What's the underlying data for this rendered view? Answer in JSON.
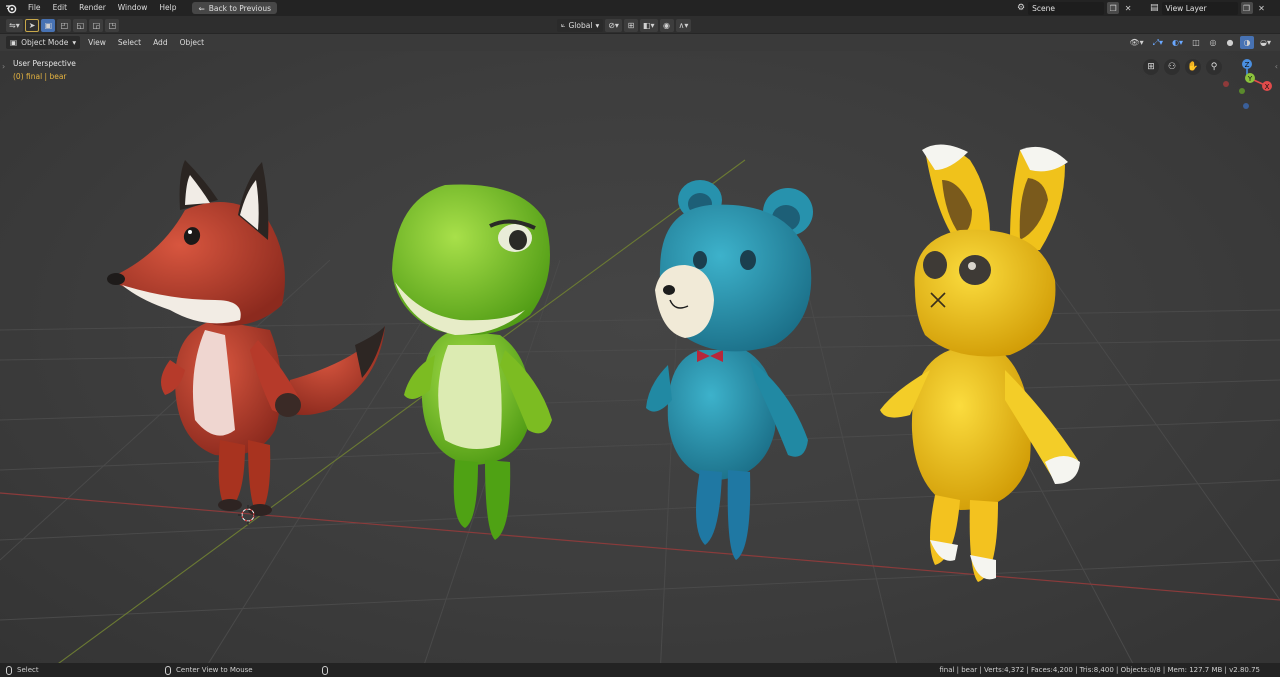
{
  "topbar": {
    "menus": [
      "File",
      "Edit",
      "Render",
      "Window",
      "Help"
    ],
    "back_button": "Back to Previous",
    "scene": "Scene",
    "view_layer": "View Layer"
  },
  "toolrow": {
    "orientation": "Global"
  },
  "header": {
    "mode": "Object Mode",
    "menus": [
      "View",
      "Select",
      "Add",
      "Object"
    ]
  },
  "viewport": {
    "title": "User Perspective",
    "subtitle": "(0) final | bear",
    "gizmo": {
      "x": "X",
      "y": "Y",
      "z": "Z"
    },
    "characters": [
      "fox",
      "frog",
      "bear",
      "bunny"
    ]
  },
  "statusbar": {
    "select": "Select",
    "center_view": "Center View to Mouse",
    "stats": "final | bear | Verts:4,372 | Faces:4,200 | Tris:8,400 | Objects:0/8 | Mem: 127.7 MB | v2.80.75"
  },
  "colors": {
    "accent": "#4772b3",
    "fox": "#c0412f",
    "frog": "#8ccb2a",
    "bear": "#2b97b2",
    "bunny": "#f0c21b",
    "x_axis": "#e24b4b",
    "y_axis": "#8cc43c",
    "z_axis": "#4a8fe0"
  }
}
